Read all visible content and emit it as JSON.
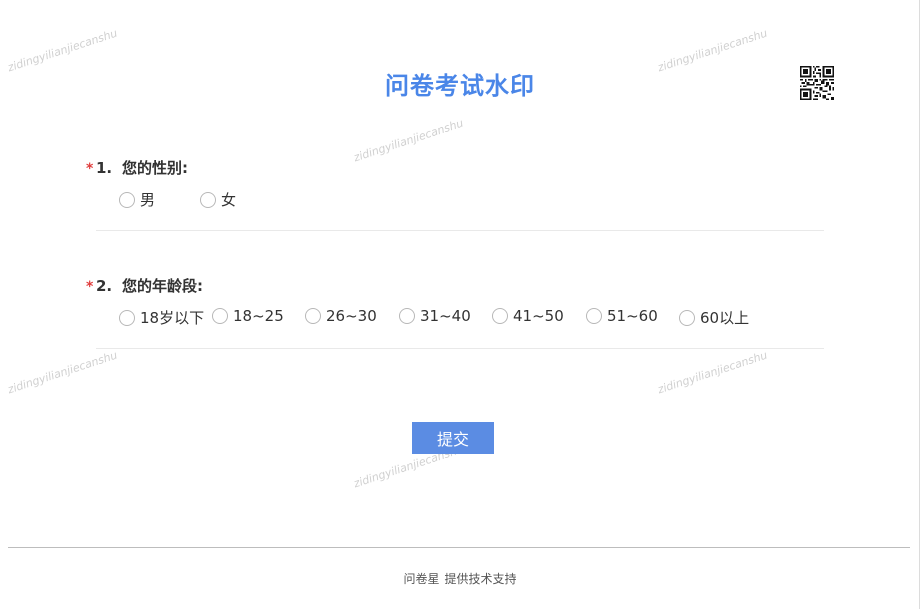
{
  "survey": {
    "title": "问卷考试水印",
    "submit_label": "提交",
    "questions": [
      {
        "required_mark": "*",
        "number": "1.",
        "text": "您的性别:",
        "options": [
          "男",
          "女"
        ]
      },
      {
        "required_mark": "*",
        "number": "2.",
        "text": "您的年龄段:",
        "options": [
          "18岁以下",
          "18~25",
          "26~30",
          "31~40",
          "41~50",
          "51~60",
          "60以上"
        ]
      }
    ]
  },
  "footer": {
    "brand": "问卷星",
    "support_text": "提供技术支持"
  },
  "watermark": {
    "text": "zidingyilianjiecanshu"
  },
  "icons": {
    "qr": "qr-code-icon"
  },
  "colors": {
    "title": "#4a86e8",
    "button": "#5b8ce3",
    "required": "#e03c3c"
  }
}
